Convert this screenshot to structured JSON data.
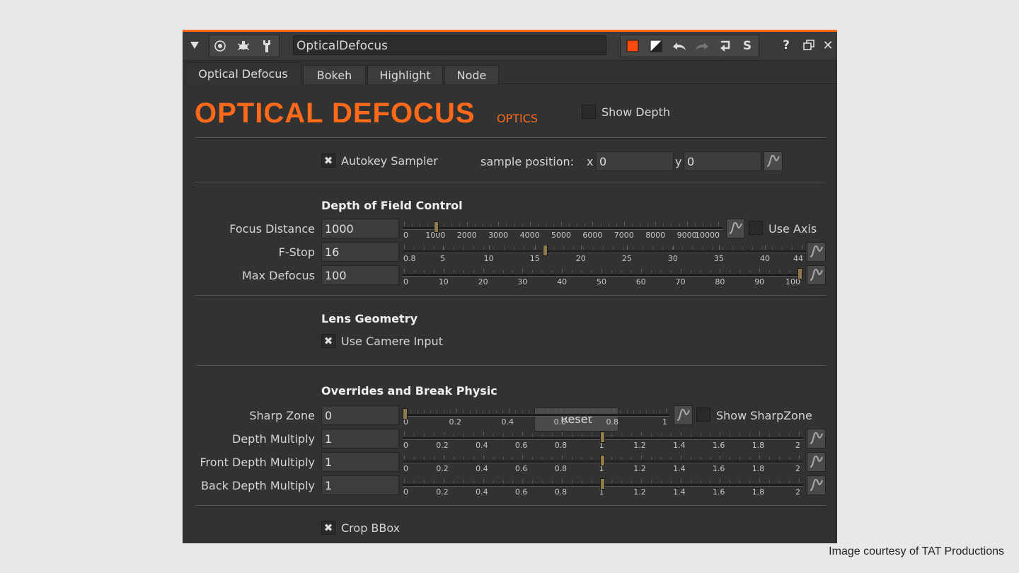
{
  "window": {
    "node_name": "OpticalDefocus",
    "icons": [
      "collapse-arrow-icon",
      "viewer-icon",
      "bug-icon",
      "wrench-icon",
      "color-swatch-icon",
      "mask-icon",
      "undo-icon",
      "redo-icon",
      "revert-icon",
      "script-icon",
      "help-icon",
      "float-icon",
      "close-icon"
    ],
    "accent": "#ff6a1a"
  },
  "tabs": [
    "Optical Defocus",
    "Bokeh",
    "Highlight",
    "Node"
  ],
  "header": {
    "title": "OPTICAL DEFOCUS",
    "subtitle": "OPTICS",
    "show_depth": "Show Depth",
    "show_depth_checked": false
  },
  "sampler": {
    "autokey_label": "Autokey Sampler",
    "autokey_checked": true,
    "sample_position_label": "sample position:",
    "x_label": "x",
    "x_value": "0",
    "y_label": "y",
    "y_value": "0"
  },
  "dof": {
    "title": "Depth of Field Control",
    "focus_distance": {
      "label": "Focus Distance",
      "value": "1000",
      "min": 0,
      "max": 10000,
      "ticks": [
        "0",
        "1000",
        "2000",
        "3000",
        "4000",
        "5000",
        "6000",
        "7000",
        "8000",
        "9000",
        "10000"
      ],
      "use_axis": "Use Axis",
      "use_axis_checked": false
    },
    "fstop": {
      "label": "F-Stop",
      "value": "16",
      "min": 0.8,
      "max": 44,
      "ticks": [
        "0.8",
        "5",
        "10",
        "15",
        "20",
        "25",
        "30",
        "35",
        "40",
        "44"
      ]
    },
    "max_defocus": {
      "label": "Max Defocus",
      "value": "100",
      "min": 0,
      "max": 100,
      "ticks": [
        "0",
        "10",
        "20",
        "30",
        "40",
        "50",
        "60",
        "70",
        "80",
        "90",
        "100"
      ]
    }
  },
  "lens": {
    "title": "Lens Geometry",
    "use_camera_input": "Use Camere Input",
    "use_camera_checked": true
  },
  "overrides": {
    "title": "Overrides and Break Physic",
    "reset_label": "Reset",
    "sharp_zone": {
      "label": "Sharp Zone",
      "value": "0",
      "min": 0,
      "max": 1,
      "ticks": [
        "0",
        "0.2",
        "0.4",
        "0.6",
        "0.8",
        "1"
      ],
      "show_sharpzone": "Show SharpZone",
      "show_sharpzone_checked": false
    },
    "depth_multiply": {
      "label": "Depth Multiply",
      "value": "1",
      "min": 0,
      "max": 2,
      "ticks": [
        "0",
        "0.2",
        "0.4",
        "0.6",
        "0.8",
        "1",
        "1.2",
        "1.4",
        "1.6",
        "1.8",
        "2"
      ]
    },
    "front_depth_multiply": {
      "label": "Front Depth Multiply",
      "value": "1",
      "min": 0,
      "max": 2,
      "ticks": [
        "0",
        "0.2",
        "0.4",
        "0.6",
        "0.8",
        "1",
        "1.2",
        "1.4",
        "1.6",
        "1.8",
        "2"
      ]
    },
    "back_depth_multiply": {
      "label": "Back Depth Multiply",
      "value": "1",
      "min": 0,
      "max": 2,
      "ticks": [
        "0",
        "0.2",
        "0.4",
        "0.6",
        "0.8",
        "1",
        "1.2",
        "1.4",
        "1.6",
        "1.8",
        "2"
      ]
    }
  },
  "crop": {
    "label": "Crop BBox",
    "checked": true
  },
  "credit": "Image courtesy of TAT Productions"
}
